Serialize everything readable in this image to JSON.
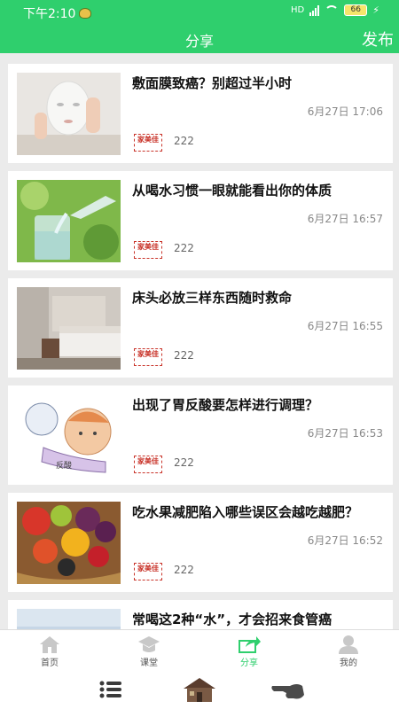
{
  "status_bar": {
    "time": "下午2:10",
    "network": "HD",
    "battery": "66"
  },
  "app_bar": {
    "title": "分享",
    "publish_label": "发布"
  },
  "articles": [
    {
      "title": "敷面膜致癌？别超过半小时",
      "date": "6月27日 17:06",
      "views": "222",
      "thumb": "face-mask-photo"
    },
    {
      "title": "从喝水习惯一眼就能看出你的体质",
      "date": "6月27日 16:57",
      "views": "222",
      "thumb": "water-pouring-photo"
    },
    {
      "title": "床头必放三样东西随时救命",
      "date": "6月27日 16:55",
      "views": "222",
      "thumb": "bedroom-photo"
    },
    {
      "title": "出现了胃反酸要怎样进行调理？",
      "date": "6月27日 16:53",
      "views": "222",
      "thumb": "acid-reflux-illustration"
    },
    {
      "title": "吃水果减肥陷入哪些误区会越吃越肥？",
      "date": "6月27日 16:52",
      "views": "222",
      "thumb": "fruit-basket-photo"
    },
    {
      "title": "常喝这2种“水”，才会招来食管癌",
      "date": "",
      "views": "",
      "thumb": "partial-photo"
    }
  ],
  "brand_logo": {
    "text": "家美佳"
  },
  "illustration_text": "反酸",
  "tabs": [
    {
      "label": "首页",
      "icon": "home-icon"
    },
    {
      "label": "课堂",
      "icon": "classroom-icon"
    },
    {
      "label": "分享",
      "icon": "share-icon",
      "active": true
    },
    {
      "label": "我的",
      "icon": "profile-icon"
    }
  ],
  "colors": {
    "accent": "#2fcf6d",
    "background": "#ebebeb",
    "logo_red": "#c9342a"
  }
}
